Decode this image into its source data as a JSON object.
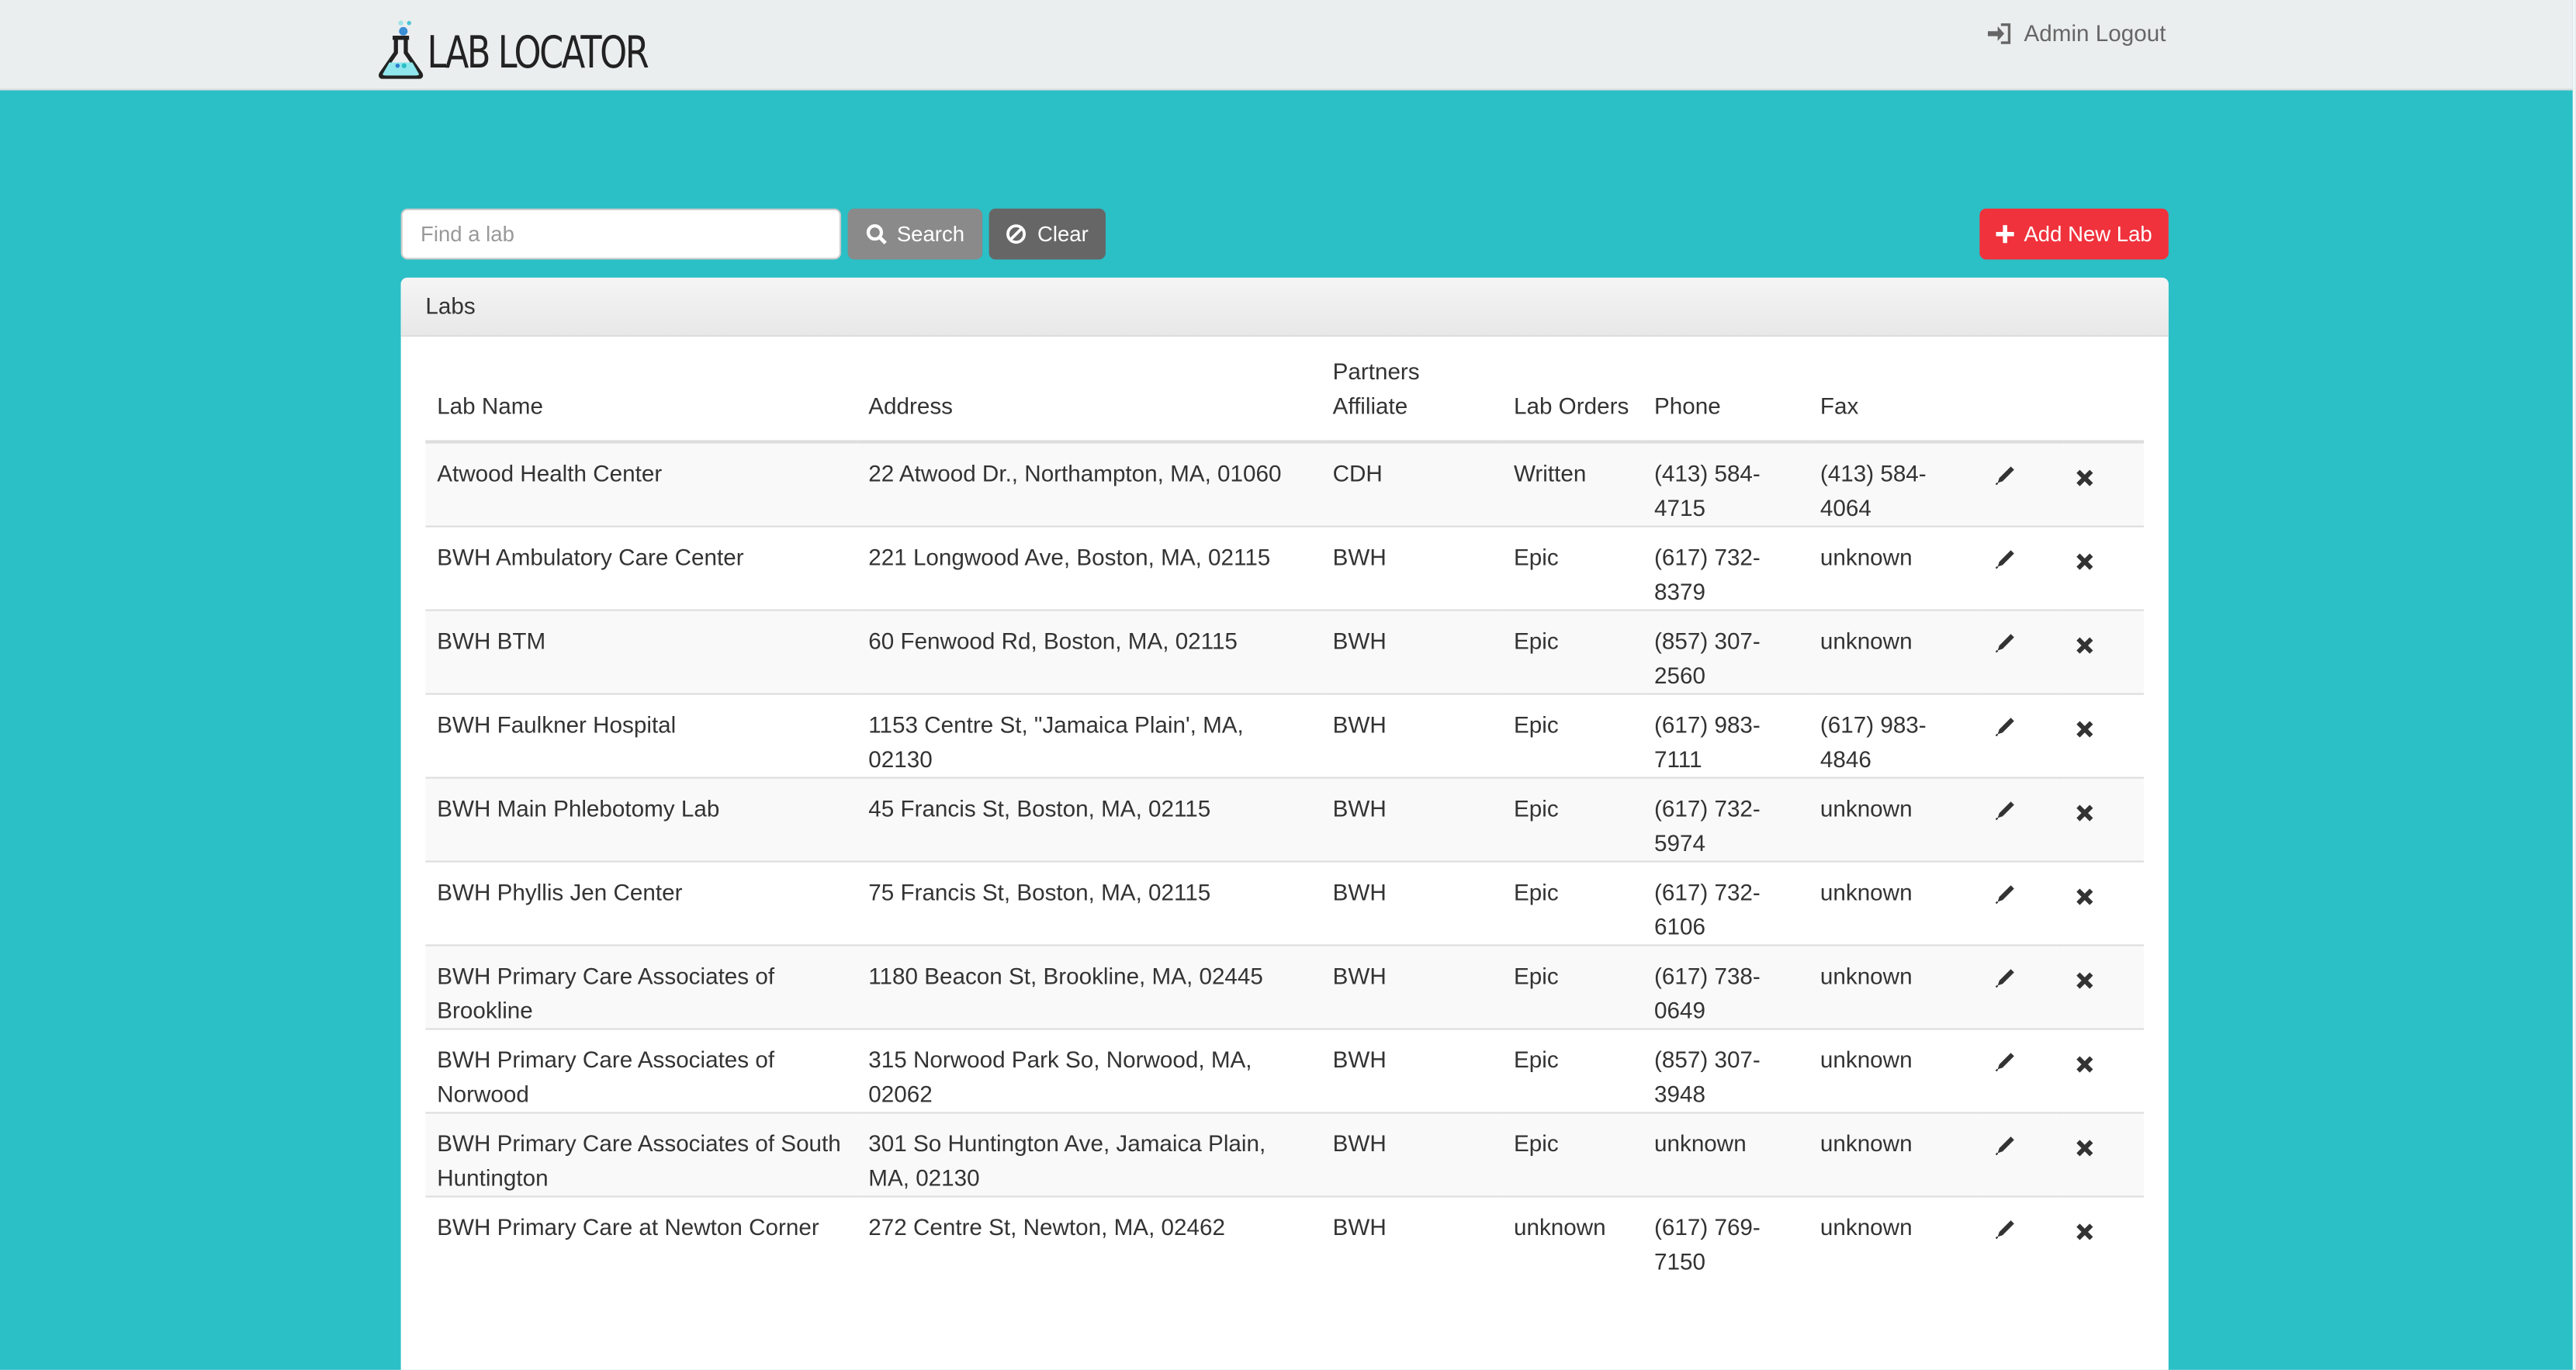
{
  "header": {
    "logo_text": "LAB LOCATOR",
    "logout_label": "Admin Logout"
  },
  "toolbar": {
    "search_placeholder": "Find a lab",
    "search_value": "",
    "search_label": "Search",
    "clear_label": "Clear",
    "add_label": "Add New Lab"
  },
  "panel": {
    "title": "Labs"
  },
  "table": {
    "columns": [
      "Lab Name",
      "Address",
      "Partners Affiliate",
      "Lab Orders",
      "Phone",
      "Fax"
    ],
    "rows": [
      [
        "Atwood Health Center",
        "22 Atwood Dr., Northampton, MA, 01060",
        "CDH",
        "Written",
        "(413) 584-4715",
        "(413) 584-4064"
      ],
      [
        "BWH Ambulatory Care Center",
        "221 Longwood Ave, Boston, MA, 02115",
        "BWH",
        "Epic",
        "(617) 732-8379",
        "unknown"
      ],
      [
        "BWH BTM",
        "60 Fenwood Rd, Boston, MA, 02115",
        "BWH",
        "Epic",
        "(857) 307-2560",
        "unknown"
      ],
      [
        "BWH Faulkner Hospital",
        "1153 Centre St, \"Jamaica Plain', MA, 02130",
        "BWH",
        "Epic",
        "(617) 983-7111",
        "(617) 983-4846"
      ],
      [
        "BWH Main Phlebotomy Lab",
        "45 Francis St, Boston, MA, 02115",
        "BWH",
        "Epic",
        "(617) 732-5974",
        "unknown"
      ],
      [
        "BWH Phyllis Jen Center",
        "75 Francis St, Boston, MA, 02115",
        "BWH",
        "Epic",
        "(617) 732-6106",
        "unknown"
      ],
      [
        "BWH Primary Care Associates of Brookline",
        "1180 Beacon St, Brookline, MA, 02445",
        "BWH",
        "Epic",
        "(617) 738-0649",
        "unknown"
      ],
      [
        "BWH Primary Care Associates of Norwood",
        "315 Norwood Park So, Norwood, MA, 02062",
        "BWH",
        "Epic",
        "(857) 307-3948",
        "unknown"
      ],
      [
        "BWH Primary Care Associates of South Huntington",
        "301 So Huntington Ave, Jamaica Plain, MA, 02130",
        "BWH",
        "Epic",
        "unknown",
        "unknown"
      ],
      [
        "BWH Primary Care at Newton Corner",
        "272 Centre St, Newton, MA, 02462",
        "BWH",
        "unknown",
        "(617) 769-7150",
        "unknown"
      ]
    ]
  },
  "colors": {
    "background": "#2bbfc6",
    "header": "#ebeeee",
    "add": "#f0323c",
    "search": "#8a8a8a",
    "clear": "#666666"
  }
}
